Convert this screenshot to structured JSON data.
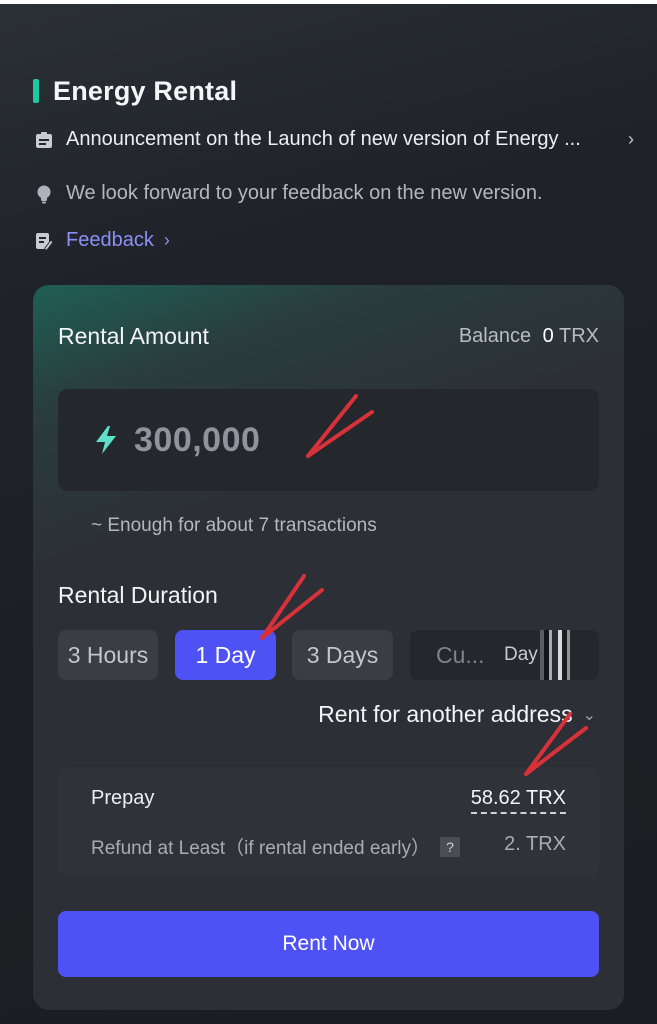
{
  "header": {
    "title": "Energy Rental"
  },
  "announcement": {
    "icon": "clipboard-icon",
    "text": "Announcement on the Launch of new version of Energy ...",
    "chevron": "›"
  },
  "feedback_note": {
    "icon": "lightbulb-icon",
    "text": "We look forward to your feedback on the new version."
  },
  "feedback_link": {
    "icon": "edit-note-icon",
    "label": "Feedback",
    "chevron": "›"
  },
  "rental": {
    "amount_label": "Rental Amount",
    "balance_label": "Balance",
    "balance_value": "0",
    "balance_unit": "TRX",
    "amount_icon": "lightning-bolt-icon",
    "amount_value": "300,000",
    "enough_text": "~ Enough for about 7 transactions",
    "duration_label": "Rental Duration",
    "durations": [
      {
        "label": "3 Hours",
        "active": false
      },
      {
        "label": "1 Day",
        "active": true
      },
      {
        "label": "3 Days",
        "active": false
      }
    ],
    "custom_placeholder": "Cu...",
    "custom_unit": "Day",
    "another_address": "Rent for another address",
    "prepay_label": "Prepay",
    "prepay_value": "58.62 TRX",
    "refund_label": "Refund at Least（if rental ended early）",
    "refund_help": "?",
    "refund_value": "2. TRX",
    "rent_button": "Rent Now"
  },
  "colors": {
    "accent": "#4e52f5",
    "teal": "#1ec8a0",
    "bolt": "#5ee0c8",
    "link": "#8c8ff8",
    "annotation_arrow": "#d8313a"
  }
}
